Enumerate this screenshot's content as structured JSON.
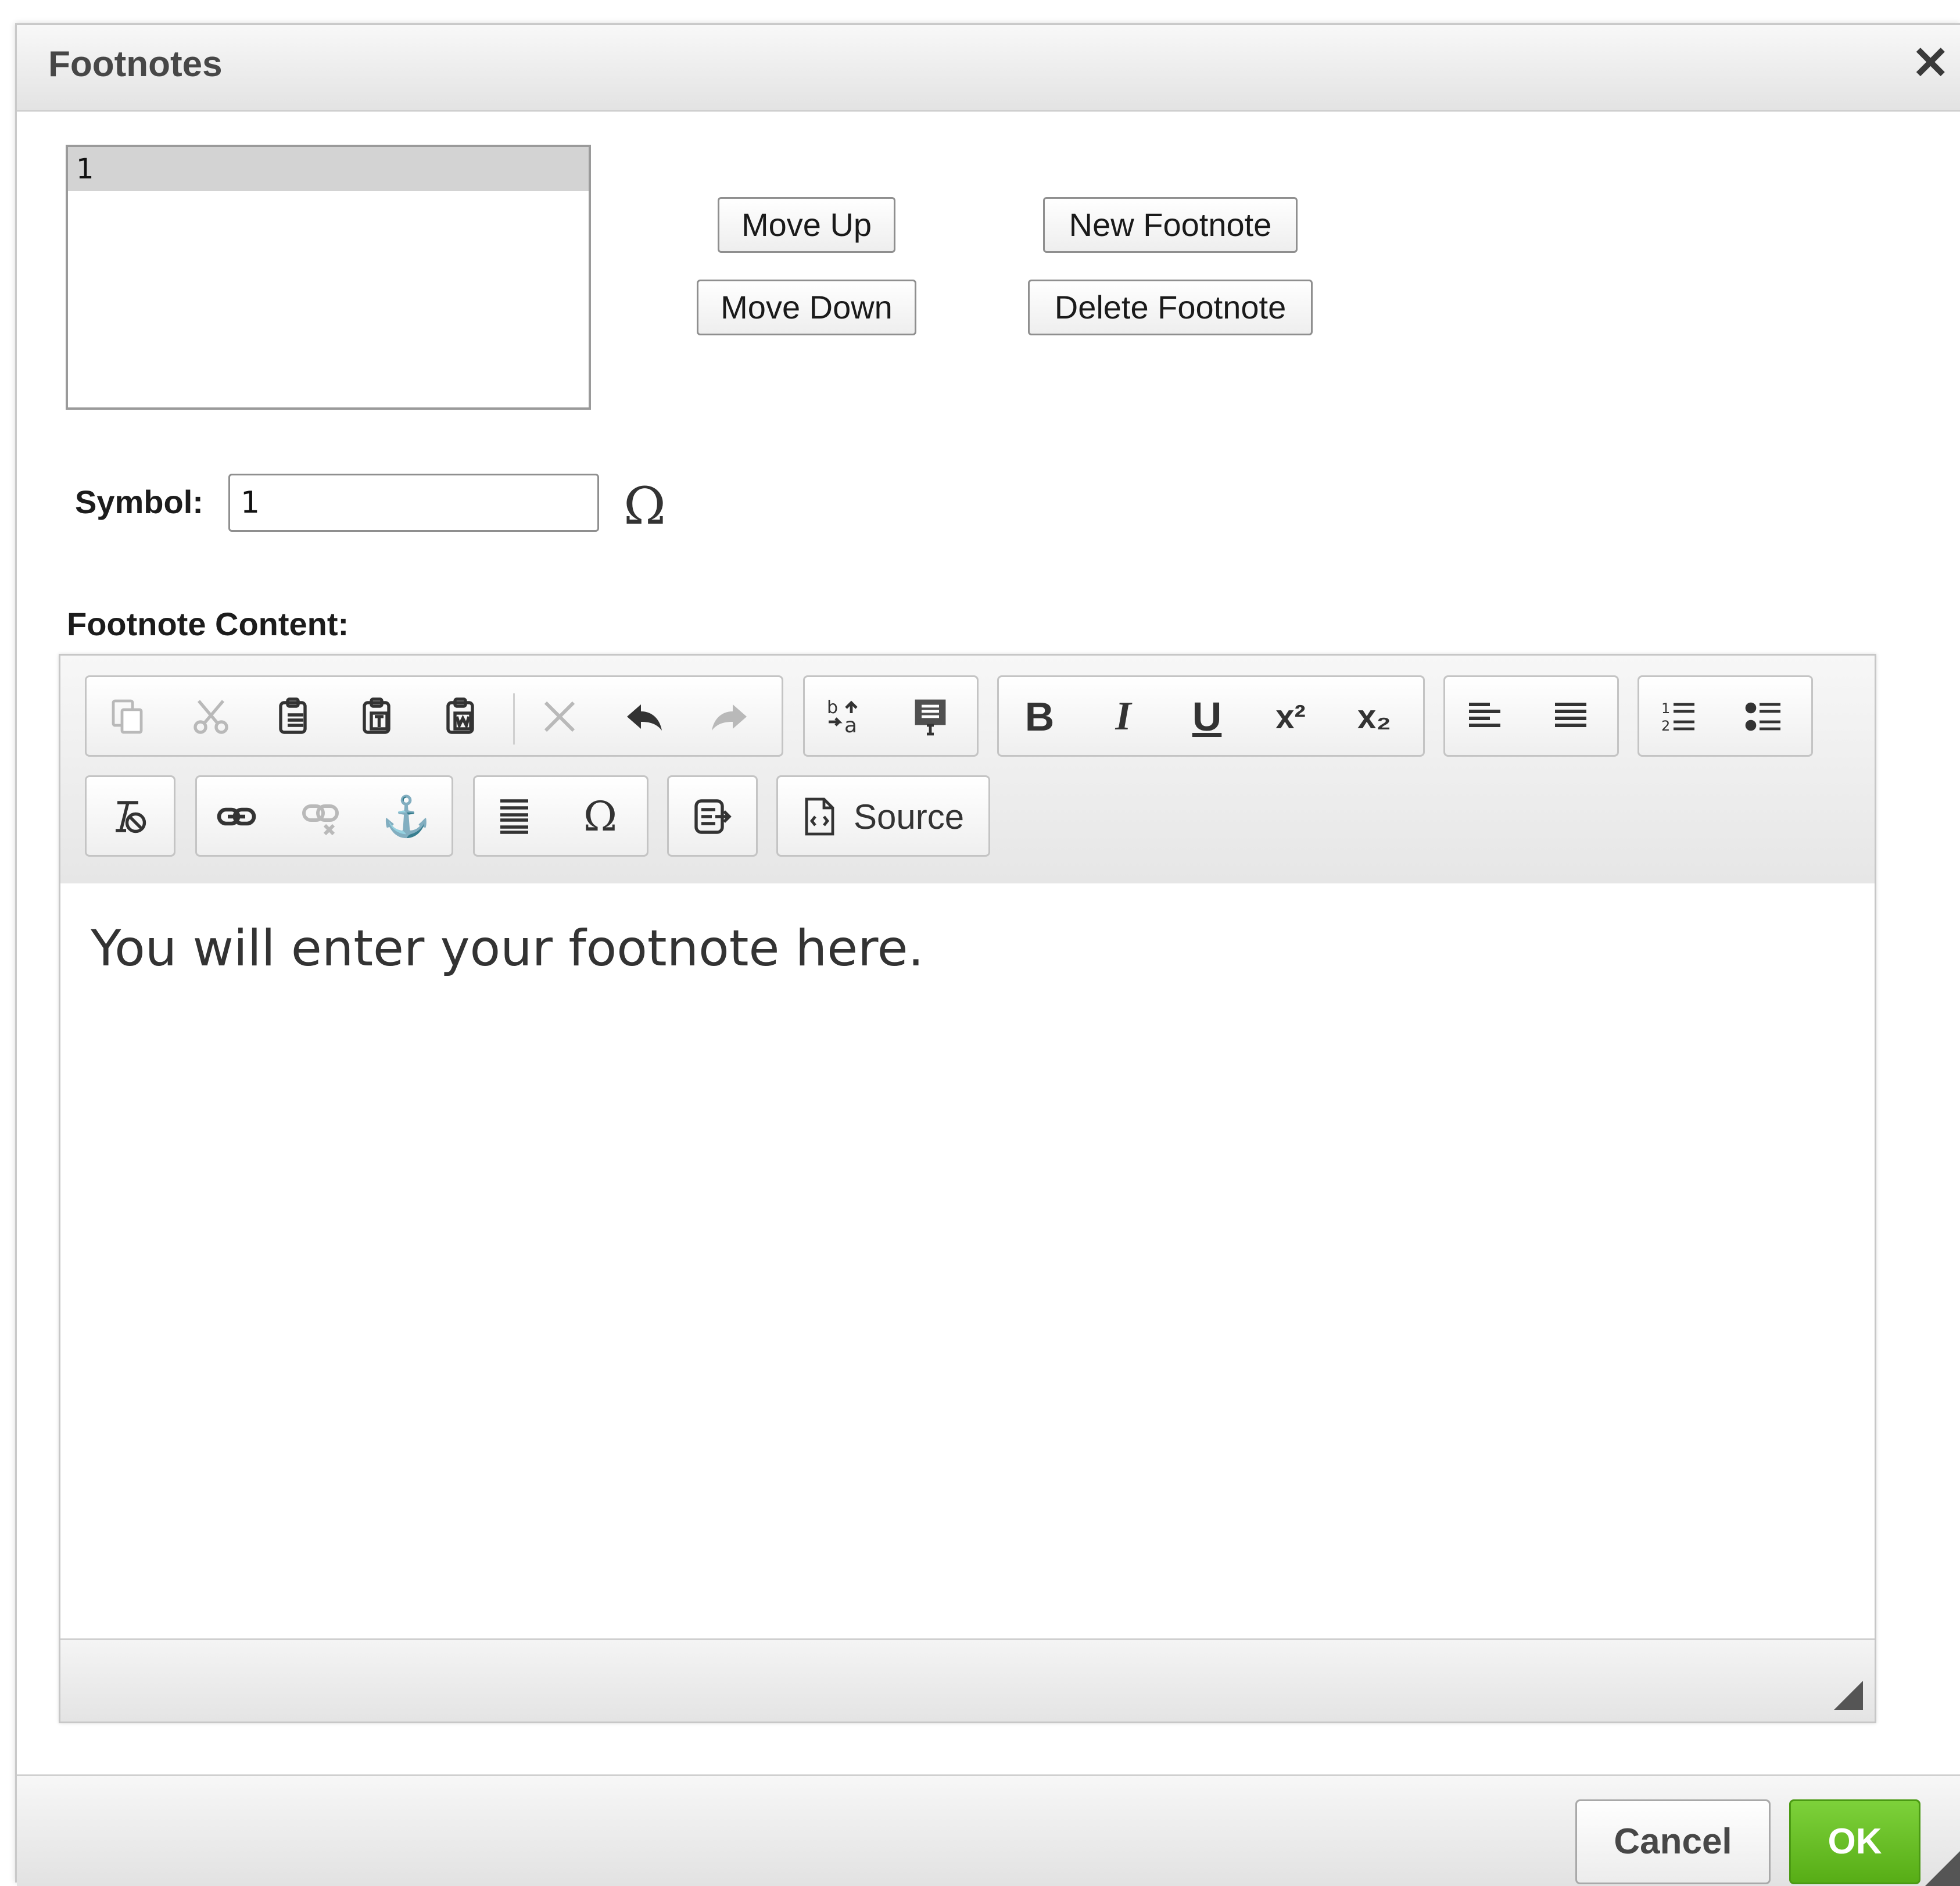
{
  "dialog": {
    "title": "Footnotes",
    "close_icon": "close-icon"
  },
  "footnote_list": {
    "items": [
      "1"
    ],
    "selected_index": 0
  },
  "buttons": {
    "move_up": "Move Up",
    "move_down": "Move Down",
    "new_footnote": "New Footnote",
    "delete_footnote": "Delete Footnote"
  },
  "symbol": {
    "label": "Symbol:",
    "value": "1",
    "special_char_glyph": "Ω"
  },
  "content": {
    "label": "Footnote Content:",
    "text": "You will enter your footnote here."
  },
  "toolbar": {
    "source_label": "Source",
    "special_char_glyph": "Ω",
    "bold_glyph": "B",
    "italic_glyph": "I",
    "underline_glyph": "U",
    "superscript_glyph": "x²",
    "subscript_glyph": "x₂",
    "anchor_glyph": "⚓",
    "icons": [
      "copy-icon",
      "cut-icon",
      "paste-icon",
      "paste-text-icon",
      "paste-word-icon",
      "remove-format-icon",
      "undo-icon",
      "redo-icon",
      "replace-icon",
      "select-all-icon",
      "bold-icon",
      "italic-icon",
      "underline-icon",
      "superscript-icon",
      "subscript-icon",
      "align-left-icon",
      "justify-icon",
      "numbered-list-icon",
      "bulleted-list-icon",
      "clear-formatting-icon",
      "link-icon",
      "unlink-icon",
      "anchor-icon",
      "horizontal-rule-icon",
      "special-char-icon",
      "template-icon",
      "source-icon"
    ]
  },
  "footer": {
    "cancel": "Cancel",
    "ok": "OK"
  },
  "colors": {
    "ok_button": "#6cc12a",
    "title_bar": "#e8e8e8"
  }
}
